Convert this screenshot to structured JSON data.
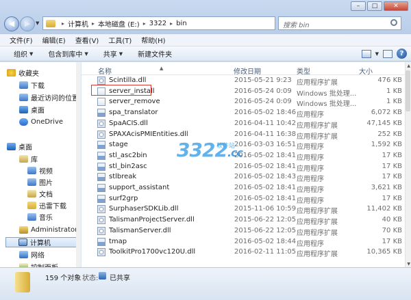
{
  "window": {
    "btn_min": "–",
    "btn_max": "□",
    "btn_close": "✕"
  },
  "address": {
    "back_label": "◀",
    "forward_label": "▶",
    "crumbs": [
      "计算机",
      "本地磁盘 (E:)",
      "3322",
      "bin"
    ],
    "search_placeholder": "搜索 bin"
  },
  "menu": [
    "文件(F)",
    "编辑(E)",
    "查看(V)",
    "工具(T)",
    "帮助(H)"
  ],
  "toolbar": {
    "organize": "组织",
    "include_in_library": "包含到库中",
    "share": "共享",
    "new_folder": "新建文件夹",
    "help": "?"
  },
  "nav": {
    "favorites": "收藏夹",
    "downloads": "下载",
    "recent": "最近访问的位置",
    "desktop_fav": "桌面",
    "onedrive": "OneDrive",
    "desktop": "桌面",
    "libraries": "库",
    "videos": "视频",
    "pictures": "图片",
    "documents": "文档",
    "xunlei": "迅雷下载",
    "music": "音乐",
    "administrator": "Administrator",
    "computer": "计算机",
    "network": "网络",
    "control_panel": "控制面板"
  },
  "columns": {
    "name": "名称",
    "date": "修改日期",
    "type": "类型",
    "size": "大小"
  },
  "files": [
    {
      "name": "Scintilla.dll",
      "date": "2015-05-21 9:23",
      "type": "应用程序扩展",
      "size": "476 KB",
      "icon": "dll"
    },
    {
      "name": "server_install",
      "date": "2016-05-24 0:09",
      "type": "Windows 批处理...",
      "size": "1 KB",
      "icon": "bat"
    },
    {
      "name": "server_remove",
      "date": "2016-05-24 0:09",
      "type": "Windows 批处理...",
      "size": "1 KB",
      "icon": "bat"
    },
    {
      "name": "spa_translator",
      "date": "2016-05-02 18:46",
      "type": "应用程序",
      "size": "6,072 KB",
      "icon": "exe"
    },
    {
      "name": "SpaACIS.dll",
      "date": "2016-04-11 10:42",
      "type": "应用程序扩展",
      "size": "47,145 KB",
      "icon": "dll"
    },
    {
      "name": "SPAXAcisPMIEntities.dll",
      "date": "2016-04-11 16:38",
      "type": "应用程序扩展",
      "size": "252 KB",
      "icon": "dll"
    },
    {
      "name": "stage",
      "date": "2016-03-03 16:51",
      "type": "应用程序",
      "size": "1,592 KB",
      "icon": "exe"
    },
    {
      "name": "stl_asc2bin",
      "date": "2016-05-02 18:41",
      "type": "应用程序",
      "size": "17 KB",
      "icon": "exe"
    },
    {
      "name": "stl_bin2asc",
      "date": "2016-05-02 18:41",
      "type": "应用程序",
      "size": "17 KB",
      "icon": "exe"
    },
    {
      "name": "stlbreak",
      "date": "2016-05-02 18:43",
      "type": "应用程序",
      "size": "17 KB",
      "icon": "exe"
    },
    {
      "name": "support_assistant",
      "date": "2016-05-02 18:41",
      "type": "应用程序",
      "size": "3,621 KB",
      "icon": "exe"
    },
    {
      "name": "surf2grp",
      "date": "2016-05-02 18:41",
      "type": "应用程序",
      "size": "17 KB",
      "icon": "exe"
    },
    {
      "name": "SurphaserSDKLib.dll",
      "date": "2015-11-06 10:59",
      "type": "应用程序扩展",
      "size": "11,402 KB",
      "icon": "dll"
    },
    {
      "name": "TalismanProjectServer.dll",
      "date": "2015-06-22 12:05",
      "type": "应用程序扩展",
      "size": "40 KB",
      "icon": "dll"
    },
    {
      "name": "TalismanServer.dll",
      "date": "2015-06-22 12:05",
      "type": "应用程序扩展",
      "size": "70 KB",
      "icon": "dll"
    },
    {
      "name": "tmap",
      "date": "2016-05-02 18:44",
      "type": "应用程序",
      "size": "17 KB",
      "icon": "exe"
    },
    {
      "name": "ToolkitPro1700vc120U.dll",
      "date": "2016-02-11 11:05",
      "type": "应用程序扩展",
      "size": "10,365 KB",
      "icon": "dll"
    }
  ],
  "highlighted_file": "server_install",
  "status": {
    "count": "159 个对象",
    "state_label": "状态:",
    "state_value": "已共享"
  },
  "watermark": {
    "main": "3322",
    "suffix": ".cc",
    "sub": "软件站"
  }
}
